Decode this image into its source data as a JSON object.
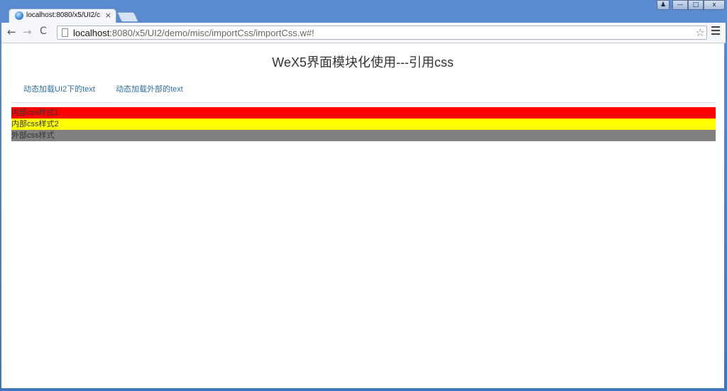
{
  "browser": {
    "tab_title": "localhost:8080/x5/UI2/c",
    "tab_close": "×",
    "url_host": "localhost",
    "url_rest": ":8080/x5/UI2/demo/misc/importCss/importCss.w#!",
    "star": "☆",
    "back": "←",
    "forward": "→",
    "reload": "C",
    "window_controls": {
      "user": "♟",
      "minimize": "—",
      "maximize": "□",
      "close": "x"
    }
  },
  "page": {
    "title": "WeX5界面模块化使用---引用css",
    "links": [
      "动态加载UI2下的text",
      "动态加载外部的text"
    ],
    "style_rows": [
      {
        "label": "内部css样式1",
        "color": "#ff0000"
      },
      {
        "label": "内部css样式2",
        "color": "#ffff00"
      },
      {
        "label": "外部css样式",
        "color": "#808080"
      }
    ]
  }
}
